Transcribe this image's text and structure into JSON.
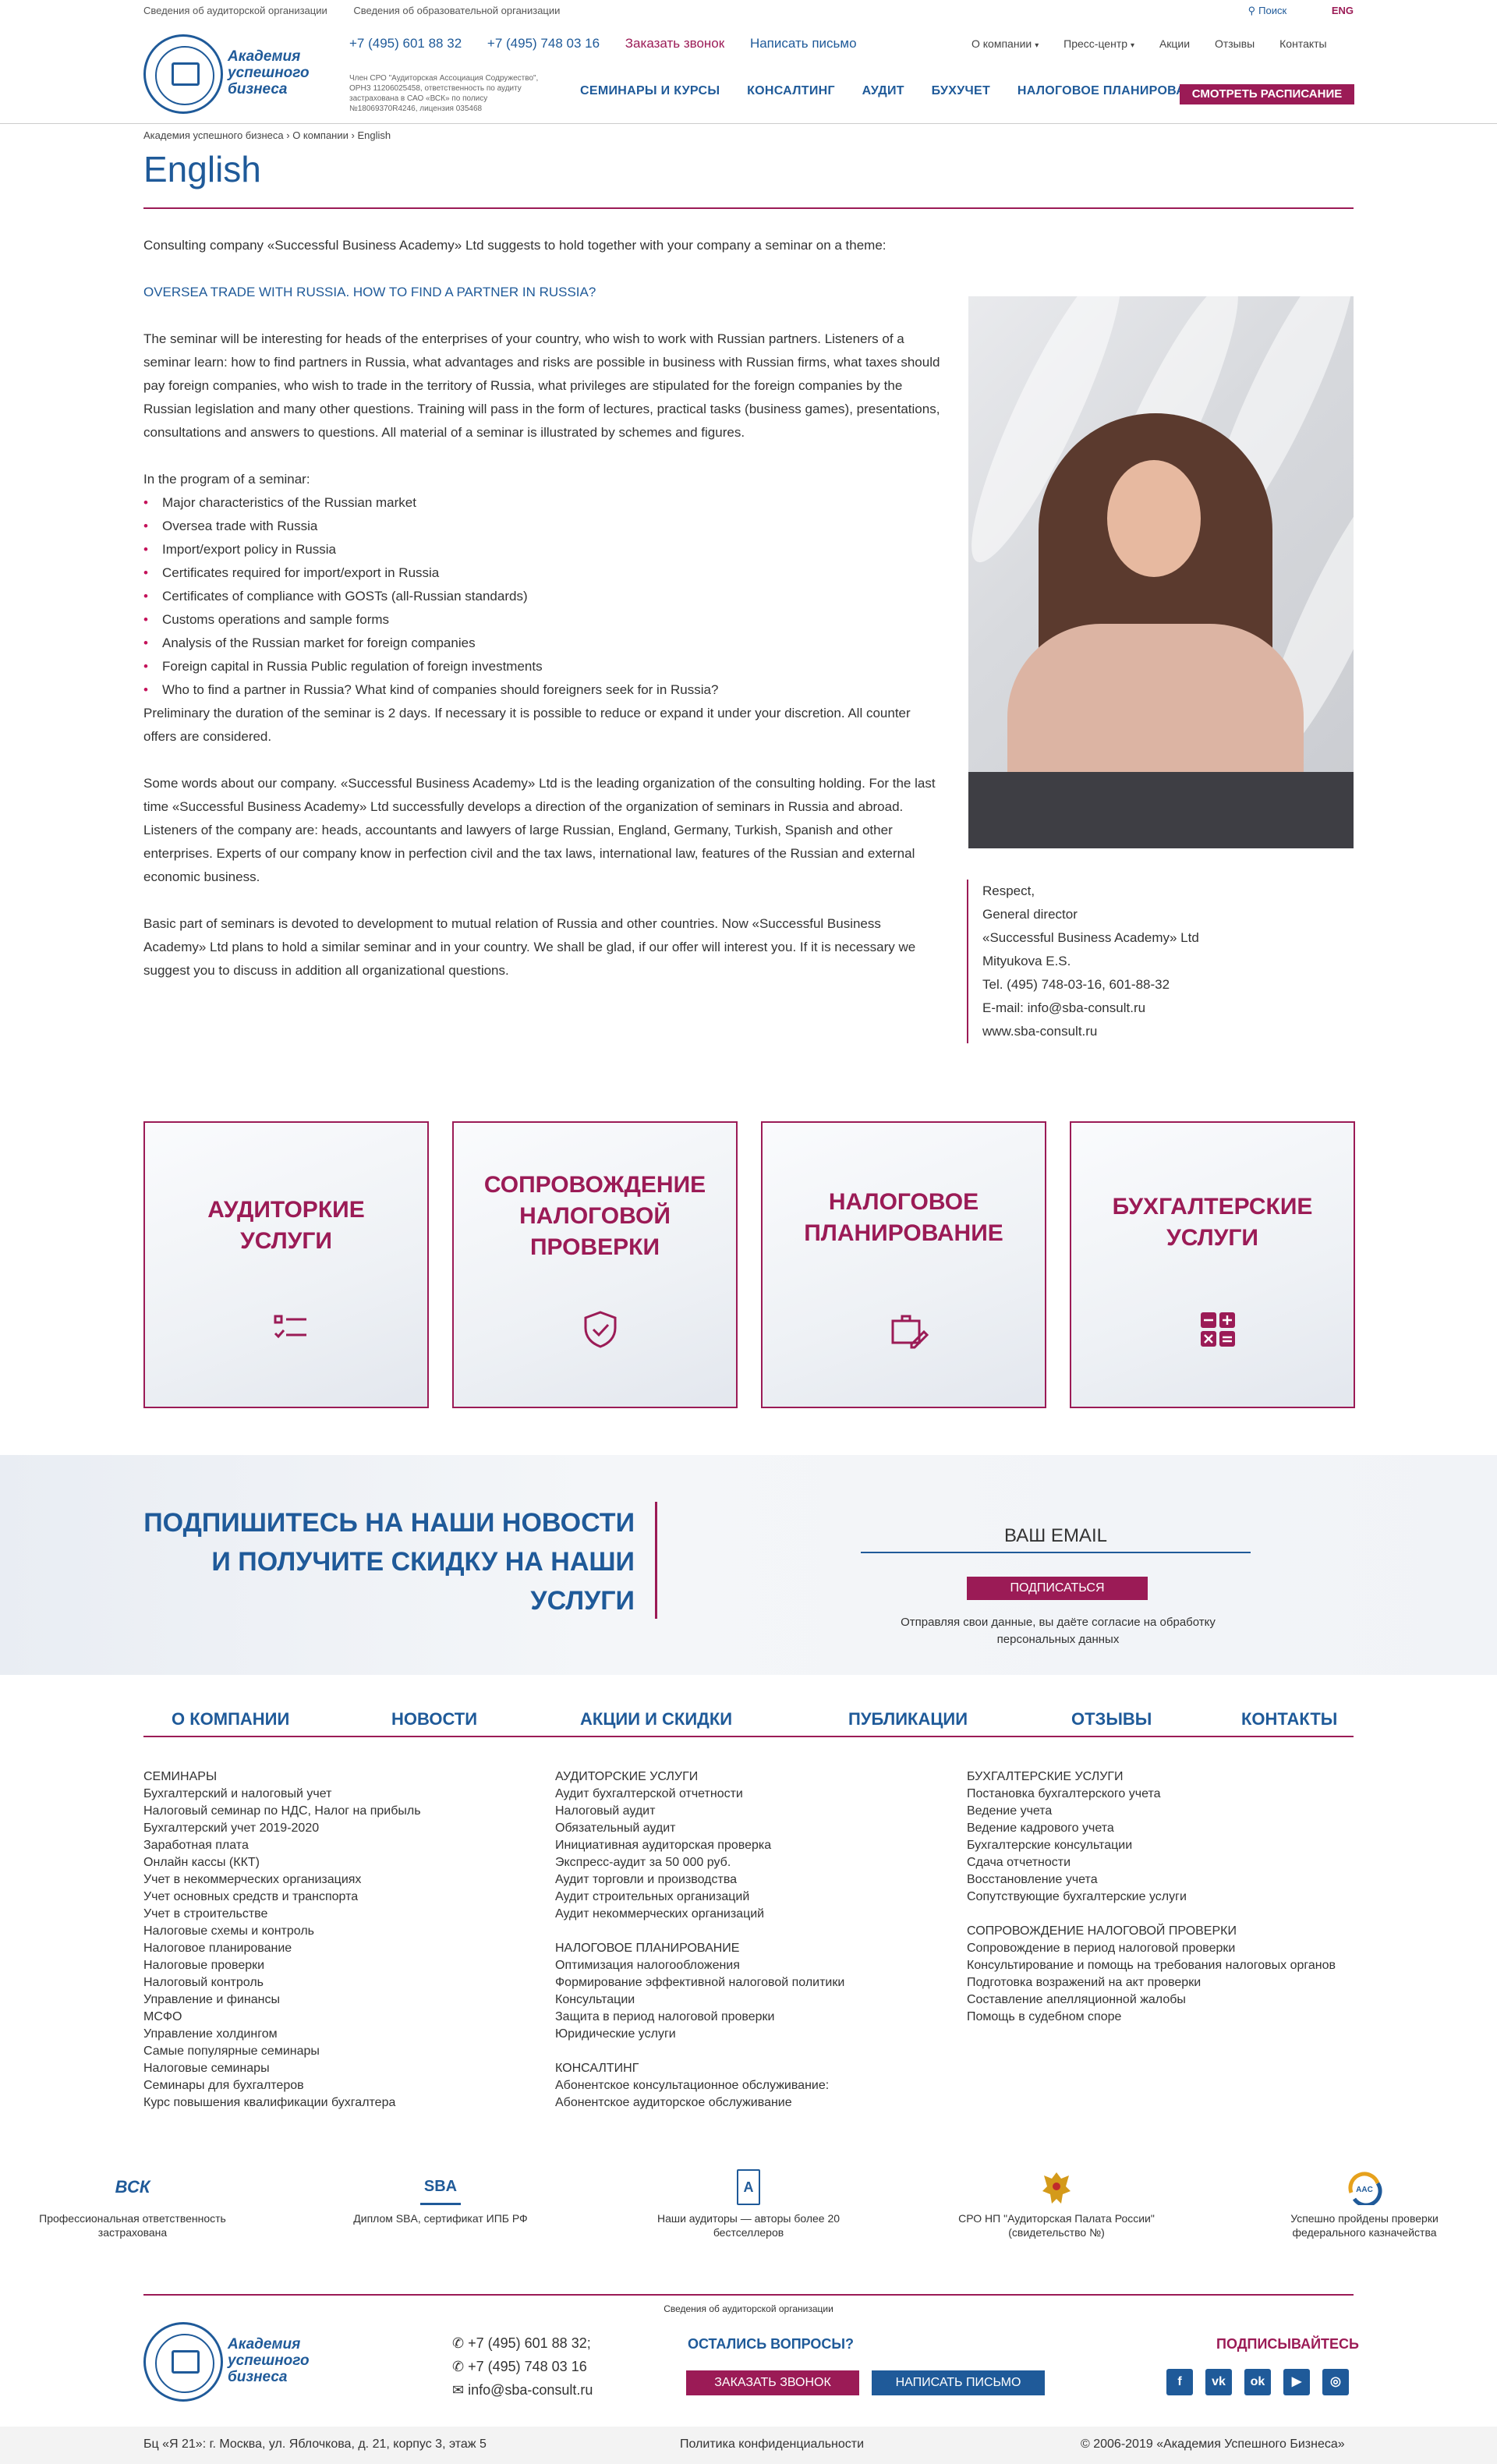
{
  "topbar": {
    "left1": "Сведения об аудиторской организации",
    "left2": "Сведения об образовательной организации",
    "search": "Поиск",
    "lang": "ENG"
  },
  "logo": {
    "line1": "Академия",
    "line2": "успешного",
    "line3": "бизнеса"
  },
  "header": {
    "phone1": "+7 (495) 601 88 32",
    "phone2": "+7 (495) 748 03 16",
    "call": "Заказать звонок",
    "write": "Написать письмо",
    "member": "Член СРО \"Аудиторская Ассоциация Содружество\", ОРНЗ 11206025458, ответственность по аудиту застрахована в САО «ВСК» по полису №18069370R4246, лицензия 035468",
    "topnav": [
      "О компании",
      "Пресс-центр",
      "Акции",
      "Отзывы",
      "Контакты"
    ],
    "mainnav": [
      "СЕМИНАРЫ И КУРСЫ",
      "КОНСАЛТИНГ",
      "АУДИТ",
      "БУХУЧЕТ",
      "НАЛОГОВОЕ ПЛАНИРОВАНИЕ"
    ],
    "schedule": "СМОТРЕТЬ РАСПИСАНИЕ"
  },
  "breadcrumb": [
    "Академия успешного бизнеса",
    "О компании",
    "English"
  ],
  "page_title": "English",
  "content": {
    "intro": "Consulting company «Successful Business Academy» Ltd suggests to hold together with your company a seminar on a theme:",
    "theme": "OVERSEA TRADE WITH RUSSIA. HOW TO FIND A PARTNER IN RUSSIA?",
    "para1": "The seminar will be interesting for heads of the enterprises of your country, who wish to work with Russian partners. Listeners of a seminar learn: how to find partners in Russia, what advantages and risks are possible in business with Russian firms, what taxes should pay foreign companies, who wish to trade in  the territory of Russia, what privileges are stipulated for the foreign companies by the Russian legislation and many other questions. Training will pass in the form of lectures, practical tasks (business games), presentations, consultations and answers to questions. All material of a seminar is illustrated by schemes and figures.",
    "program_title": "In the program of a seminar:",
    "program": [
      "Major characteristics of the Russian market",
      "Oversea trade with Russia",
      "Import/export policy in Russia",
      "Certificates required for import/export in Russia",
      "Certificates of compliance with GOSTs (all-Russian standards)",
      "Customs operations and sample forms",
      "Analysis of the Russian market for foreign companies",
      "Foreign capital in Russia Public regulation of foreign investments",
      "Who to find a partner in Russia? What kind of companies should foreigners seek for in Russia?"
    ],
    "duration": "Preliminary the duration of the seminar is 2 days. If necessary it is possible to reduce or expand it under your discretion. All counter offers are considered.",
    "para2": "Some words about our company. «Successful Business Academy» Ltd is the leading organization of the consulting holding. For the last time «Successful Business Academy» Ltd successfully develops a direction of the organization of seminars in Russia and abroad.",
    "para3": "Listeners of the company are: heads, accountants and lawyers of large Russian, England, Germany, Turkish, Spanish and other enterprises. Experts of our company know in perfection civil and the tax laws, international law, features of the Russian and external economic business.",
    "para4": "Basic part of seminars is devoted to development to mutual relation of Russia and other countries. Now «Successful Business Academy» Ltd plans to hold a similar seminar and in your country. We shall be glad, if our offer will interest you. If it is necessary we suggest you to discuss in addition all organizational questions."
  },
  "signature": [
    "Respect,",
    "General director",
    "«Successful Business Academy» Ltd",
    "Mityukova E.S.",
    "Tel. (495) 748-03-16, 601-88-32",
    "E-mail: info@sba-consult.ru",
    "www.sba-consult.ru"
  ],
  "services": [
    {
      "label": "Аудиторкие услуги",
      "icon": "checklist-icon"
    },
    {
      "label": "Сопровождение налоговой проверки",
      "icon": "shield-check-icon"
    },
    {
      "label": "Налоговое планирование",
      "icon": "briefcase-edit-icon"
    },
    {
      "label": "Бухгалтерские услуги",
      "icon": "calculator-icon"
    }
  ],
  "subscribe": {
    "text": "ПОДПИШИТЕСЬ НА НАШИ НОВОСТИ И ПОЛУЧИТЕ СКИДКУ НА НАШИ УСЛУГИ",
    "placeholder": "ВАШ EMAIL",
    "button": "ПОДПИСАТЬСЯ",
    "consent": "Отправляя свои данные, вы даёте согласие на обработку персональных данных"
  },
  "footer_nav": [
    "О КОМПАНИИ",
    "НОВОСТИ",
    "АКЦИИ И СКИДКИ",
    "ПУБЛИКАЦИИ",
    "ОТЗЫВЫ",
    "КОНТАКТЫ"
  ],
  "footer_col1": [
    "СЕМИНАРЫ",
    "Бухгалтерский и налоговый учет",
    "Налоговый семинар по НДС, Налог на прибыль",
    "Бухгалтерский учет 2019-2020",
    "Заработная плата",
    "Онлайн кассы (ККТ)",
    "Учет в некоммерческих организациях",
    "Учет основных средств и транспорта",
    "Учет в строительстве",
    "Налоговые схемы и контроль",
    "Налоговое планирование",
    "Налоговые проверки",
    "Налоговый контроль",
    "Управление и финансы",
    "МСФО",
    "Управление холдингом",
    "Самые популярные семинары",
    "Налоговые семинары",
    "Семинары для бухгалтеров",
    "Курс повышения квалификации бухгалтера"
  ],
  "footer_col2": [
    "АУДИТОРСКИЕ УСЛУГИ",
    "Аудит бухгалтерской отчетности",
    "Налоговый аудит",
    "Обязательный аудит",
    "Инициативная аудиторская проверка",
    "Экспресс-аудит за 50 000 руб.",
    "Аудит торговли и производства",
    "Аудит строительных организаций",
    "Аудит некоммерческих организаций",
    "",
    "НАЛОГОВОЕ ПЛАНИРОВАНИЕ",
    "Оптимизация налогообложения",
    "Формирование эффективной налоговой политики",
    "Консультации",
    "Защита в период налоговой проверки",
    "Юридические услуги",
    "",
    "КОНСАЛТИНГ",
    "Абонентское консультационное обслуживание:",
    "Абонентское аудиторское обслуживание"
  ],
  "footer_col3": [
    "БУХГАЛТЕРСКИЕ УСЛУГИ",
    "Постановка бухгалтерского учета",
    "Ведение учета",
    "Ведение кадрового учета",
    "Бухгалтерские консультации",
    "Сдача отчетности",
    "Восстановление учета",
    "Сопутствующие бухгалтерские услуги",
    "",
    "СОПРОВОЖДЕНИЕ НАЛОГОВОЙ ПРОВЕРКИ",
    "Сопровождение в период налоговой проверки",
    "Консультирование и помощь на требования налоговых органов",
    "Подготовка возражений на акт проверки",
    "Составление апелляционной жалобы",
    "Помощь в судебном споре"
  ],
  "badges": [
    {
      "text": "Профессиональная ответственность застрахована",
      "mark": "ВСК"
    },
    {
      "text": "Диплом SBA, сертификат ИПБ РФ",
      "mark": "SBA"
    },
    {
      "text": "Наши аудиторы — авторы более 20 бестселлеров",
      "mark": "A"
    },
    {
      "text": "СРО НП \"Аудиторская Палата России\" (свидетельство №)",
      "mark": ""
    },
    {
      "text": "Успешно пройдены проверки федерального казначейства",
      "mark": "AAC"
    }
  ],
  "footer": {
    "small": "Сведения об аудиторской организации",
    "phone1": "+7 (495) 601 88 32;",
    "phone2": "+7 (495) 748 03 16",
    "email": "info@sba-consult.ru",
    "questions": "ОСТАЛИСЬ ВОПРОСЫ?",
    "call": "ЗАКАЗАТЬ ЗВОНОК",
    "write": "НАПИСАТЬ ПИСЬМО",
    "subscribe": "ПОДПИСЫВАЙТЕСЬ",
    "social": [
      "f",
      "vk",
      "ok",
      "▶",
      "◎"
    ],
    "address": "Бц «Я 21»: г. Москва, ул. Яблочкова, д. 21, корпус 3, этаж 5",
    "policy": "Политика конфиденциальности",
    "copyright": "© 2006-2019 «Академия Успешного Бизнеса»"
  },
  "colors": {
    "brand_blue": "#1f5a99",
    "accent": "#9b1b56"
  }
}
